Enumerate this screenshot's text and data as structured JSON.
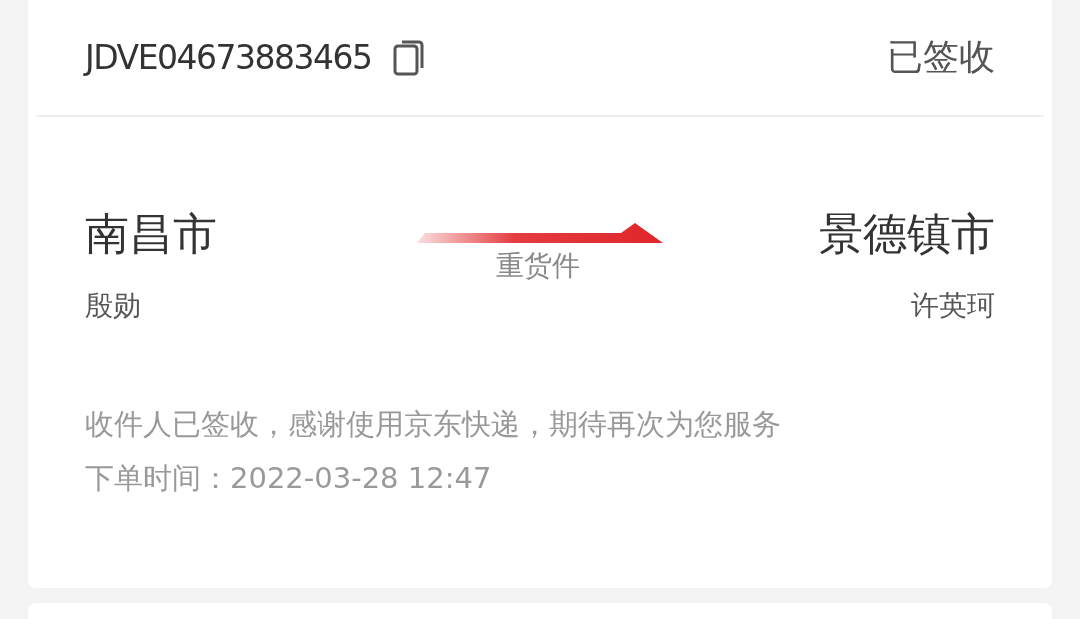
{
  "shipment": {
    "tracking_number": "JDVE04673883465",
    "status": "已签收",
    "origin": {
      "city": "南昌市",
      "person": "殷勋"
    },
    "destination": {
      "city": "景德镇市",
      "person": "许英珂"
    },
    "cargo_type": "重货件",
    "message": "收件人已签收，感谢使用京东快递，期待再次为您服务",
    "order_time": "下单时间：2022-03-28 12:47"
  }
}
